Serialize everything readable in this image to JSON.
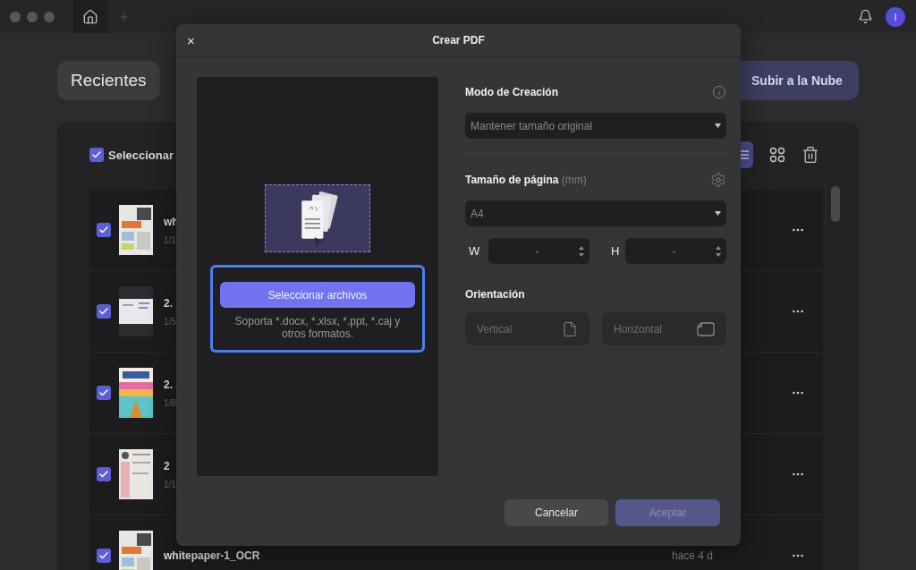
{
  "app": {
    "avatar": "I",
    "recent_button": "Recientes",
    "cloud_button": "Subir a la Nube",
    "select_all": {
      "label": "Seleccionar",
      "checked": true
    },
    "view": {
      "list_selected": true
    },
    "files": [
      {
        "name": "wh",
        "pages": "1/1",
        "checked": true
      },
      {
        "name": "2.",
        "pages": "1/5",
        "checked": true
      },
      {
        "name": "2.",
        "pages": "1/8",
        "checked": true
      },
      {
        "name": "2",
        "pages": "1/1",
        "checked": true
      },
      {
        "name": "whitepaper-1_OCR",
        "date": "hace 4 d",
        "checked": true
      }
    ]
  },
  "dialog": {
    "title": "Crear PDF",
    "close": "×",
    "preview": {
      "select_button": "Seleccionar archivos",
      "support_text": "Soporta *.docx, *.xlsx, *.ppt, *.caj y otros formatos."
    },
    "creation_mode": {
      "label": "Modo de Creación",
      "value": "Mantener tamaño original"
    },
    "page_size": {
      "label": "Tamaño de página",
      "unit": "(mm)",
      "value": "A4"
    },
    "width": {
      "label": "W",
      "value": "-"
    },
    "height": {
      "label": "H",
      "value": "-"
    },
    "orientation": {
      "label": "Orientación",
      "options": [
        {
          "label": "Vertical",
          "kind": "portrait",
          "selected": false
        },
        {
          "label": "Horizontal",
          "kind": "landscape",
          "selected": false
        }
      ]
    },
    "cancel": "Cancelar",
    "accept": {
      "label": "Aceptar",
      "disabled": true
    }
  }
}
